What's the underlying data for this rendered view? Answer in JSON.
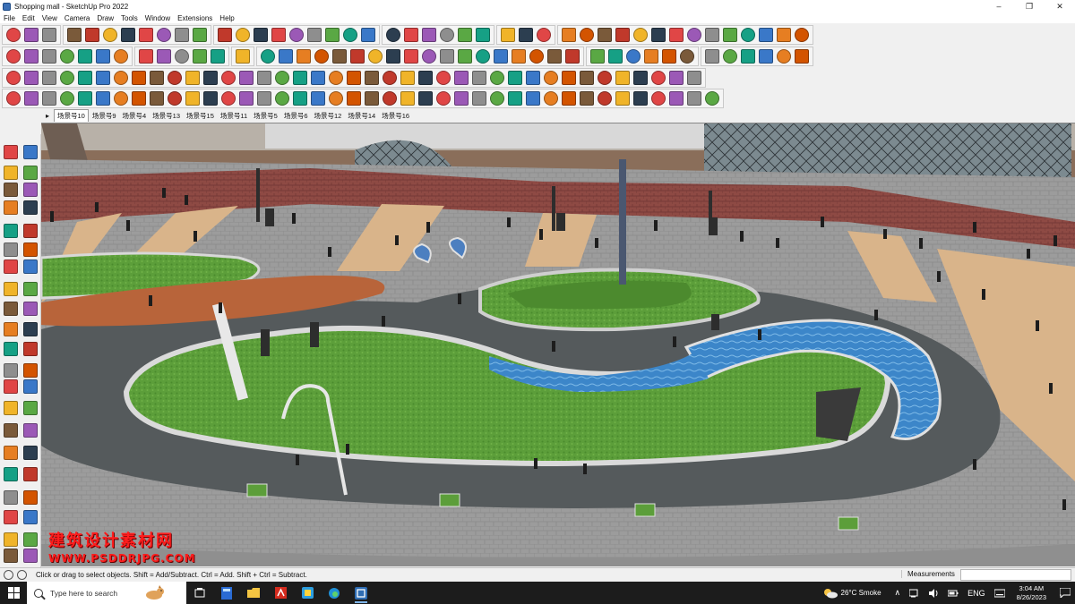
{
  "window": {
    "title": "Shopping mall - SketchUp Pro 2022",
    "controls": {
      "minimize": "–",
      "maximize": "❐",
      "close": "✕"
    }
  },
  "menu": [
    "File",
    "Edit",
    "View",
    "Camera",
    "Draw",
    "Tools",
    "Window",
    "Extensions",
    "Help"
  ],
  "scene_tabs": [
    "场景号10",
    "场景号9",
    "场景号4",
    "场景号13",
    "场景号15",
    "场景号11",
    "场景号5",
    "场景号6",
    "场景号12",
    "场景号14",
    "场景号16"
  ],
  "active_scene": "场景号10",
  "scene_tab_arrow": "▸",
  "status": {
    "message": "Click or drag to select objects. Shift = Add/Subtract. Ctrl = Add. Shift + Ctrl = Subtract.",
    "measurements_label": "Measurements",
    "measurements_value": ""
  },
  "watermark": {
    "text": "建筑设计素材网",
    "url": "WWW.PSDDRJPG.COM"
  },
  "taskbar": {
    "search_placeholder": "Type here to search",
    "apps": [
      "task-view",
      "calculator",
      "file-explorer",
      "acrobat",
      "python",
      "edge",
      "sketchup"
    ],
    "weather": "26°C  Smoke",
    "language": "ENG",
    "time": "3:04 AM",
    "date": "8/26/2023",
    "tray_chevron": "∧"
  },
  "colors": {
    "accent_red": "#ff1d1d",
    "taskbar_bg": "#1c1c1c",
    "lawn_green": "#5c9e3a",
    "water_blue": "#3c86c9"
  }
}
